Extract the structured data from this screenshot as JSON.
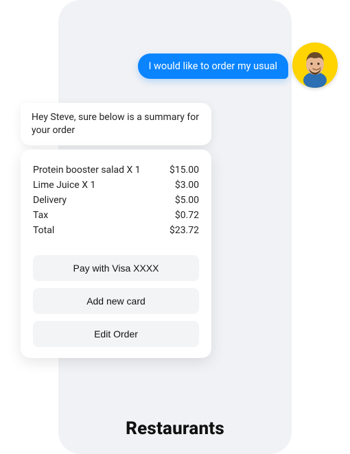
{
  "title": "Restaurants",
  "user_message": "I would like to order my usual",
  "bot_message": "Hey Steve, sure below is a summary for your order",
  "order": {
    "lines": [
      {
        "label": "Protein booster salad X 1",
        "price": "$15.00"
      },
      {
        "label": "Lime Juice X 1",
        "price": "$3.00"
      },
      {
        "label": "Delivery",
        "price": "$5.00"
      },
      {
        "label": "Tax",
        "price": "$0.72"
      },
      {
        "label": "Total",
        "price": "$23.72"
      }
    ]
  },
  "buttons": {
    "pay": "Pay with Visa XXXX",
    "add_card": "Add new card",
    "edit": "Edit Order"
  },
  "avatar_icon": "user-avatar"
}
